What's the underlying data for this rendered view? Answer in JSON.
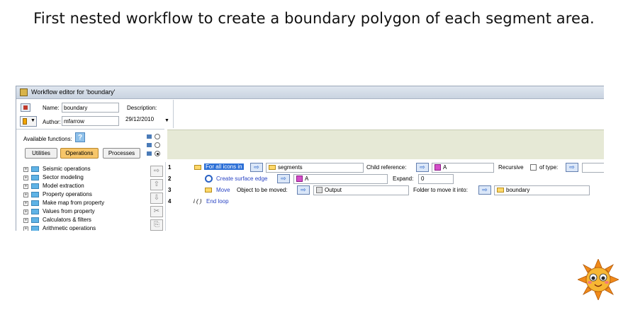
{
  "slide": {
    "title": "First nested workflow to create a boundary polygon of each segment area."
  },
  "window": {
    "title": "Workflow editor for 'boundary'"
  },
  "header": {
    "name_label": "Name:",
    "name_value": "boundary",
    "description_label": "Description:",
    "author_label": "Author:",
    "author_value": "mfarrow",
    "date_value": "29/12/2010",
    "date_dropdown": "▼"
  },
  "left": {
    "available_functions_label": "Available functions:",
    "help_icon": "?",
    "tabs": [
      "Utilities",
      "Operations",
      "Processes"
    ],
    "active_tab": "Operations",
    "tree": [
      "Seismic operations",
      "Sector modeling",
      "Model extraction",
      "Property operations",
      "Make map from property",
      "Values from property",
      "Calculators & filters",
      "Arithmetic operations"
    ],
    "side_buttons": [
      "⇨",
      "⇧",
      "⇩",
      "✂",
      "⎘"
    ]
  },
  "rows": {
    "r1": {
      "num": "1",
      "keyword": "For all icons in",
      "arrow": "⇨",
      "input": "segments",
      "child_ref_label": "Child reference:",
      "child_arrow": "⇨",
      "child_value": "A",
      "recursive_label": "Recursive",
      "of_type_label": "of type:",
      "type_arrow": "⇨"
    },
    "r2": {
      "num": "2",
      "keyword": "Create surface edge",
      "arrow": "⇨",
      "input": "A",
      "expand_label": "Expand:",
      "expand_value": "0"
    },
    "r3": {
      "num": "3",
      "keyword": "Move",
      "object_label": "Object to be moved:",
      "arrow": "⇨",
      "object_value": "Output",
      "folder_label": "Folder to move it into:",
      "folder_arrow": "⇨",
      "folder_value": "boundary"
    },
    "r4": {
      "num": "4",
      "marker": "i ( )",
      "keyword": "End loop"
    }
  },
  "colors": {
    "selection": "#2c6fd6",
    "active_tab": "#f7c66a",
    "keyword_blue": "#2a44c4",
    "panel_green": "#e6e9d6"
  },
  "icons": {
    "mascot": "sun-mascot-icon"
  }
}
